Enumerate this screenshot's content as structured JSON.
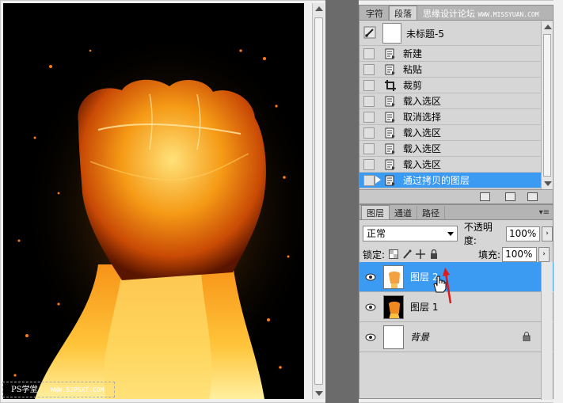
{
  "watermark": {
    "bottom_left": "PS学堂",
    "bottom_site": "WWW.52PSXT.COM",
    "top_cn": "思缘设计论坛",
    "top_site": "WWW.MISSYUAN.COM"
  },
  "history": {
    "tabs": [
      "字符",
      "段落"
    ],
    "snapshot_label": "未标题-5",
    "items": [
      {
        "label": "新建",
        "icon": "step-icon"
      },
      {
        "label": "粘贴",
        "icon": "step-icon"
      },
      {
        "label": "裁剪",
        "icon": "crop-icon"
      },
      {
        "label": "载入选区",
        "icon": "step-icon"
      },
      {
        "label": "取消选择",
        "icon": "step-icon"
      },
      {
        "label": "载入选区",
        "icon": "step-icon"
      },
      {
        "label": "载入选区",
        "icon": "step-icon"
      },
      {
        "label": "载入选区",
        "icon": "step-icon"
      },
      {
        "label": "通过拷贝的图层",
        "icon": "step-icon",
        "selected": true
      }
    ]
  },
  "layers": {
    "tabs": [
      "图层",
      "通道",
      "路径"
    ],
    "blend_mode": "正常",
    "opacity_label": "不透明度:",
    "opacity_value": "100%",
    "lock_label": "锁定:",
    "fill_label": "填充:",
    "fill_value": "100%",
    "items": [
      {
        "name": "图层 2",
        "selected": true
      },
      {
        "name": "图层 1",
        "selected": false
      },
      {
        "name": "背景",
        "selected": false
      }
    ]
  },
  "colors": {
    "selection": "#3b9af2",
    "panel_bg": "#d6d6d6",
    "workspace": "#6b6b6b"
  }
}
